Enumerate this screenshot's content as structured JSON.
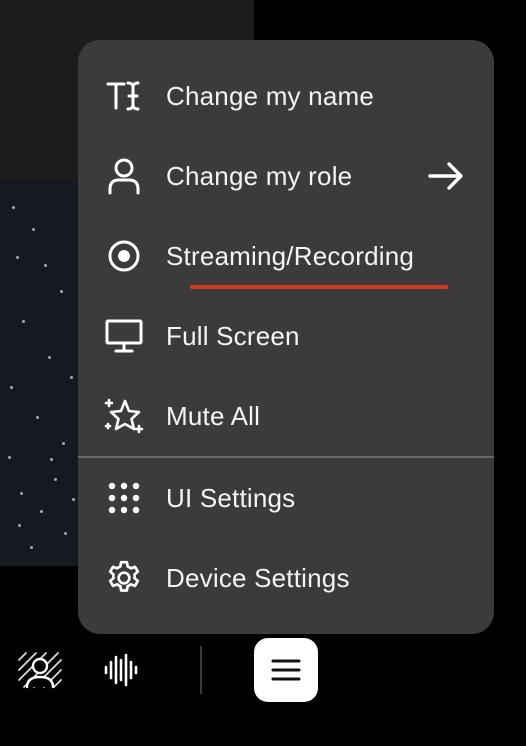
{
  "menu": {
    "items": [
      {
        "label": "Change my name",
        "icon": "text-cursor-icon"
      },
      {
        "label": "Change my role",
        "icon": "person-icon",
        "submenu": true
      },
      {
        "label": "Streaming/Recording",
        "icon": "record-icon",
        "highlighted": true
      },
      {
        "label": "Full Screen",
        "icon": "monitor-icon"
      },
      {
        "label": "Mute All",
        "icon": "sparkle-star-icon"
      },
      {
        "label": "UI Settings",
        "icon": "dots-grid-icon"
      },
      {
        "label": "Device Settings",
        "icon": "gear-icon"
      }
    ]
  },
  "toolbar": {
    "buttons": [
      {
        "icon": "virtual-background-icon"
      },
      {
        "icon": "audio-wave-icon"
      },
      {
        "icon": "hamburger-menu-icon",
        "active": true
      }
    ]
  },
  "colors": {
    "menu_bg": "#3b3b3b",
    "accent_underline": "#d23a26",
    "text": "#f4f4f4",
    "active_button_bg": "#ffffff"
  }
}
